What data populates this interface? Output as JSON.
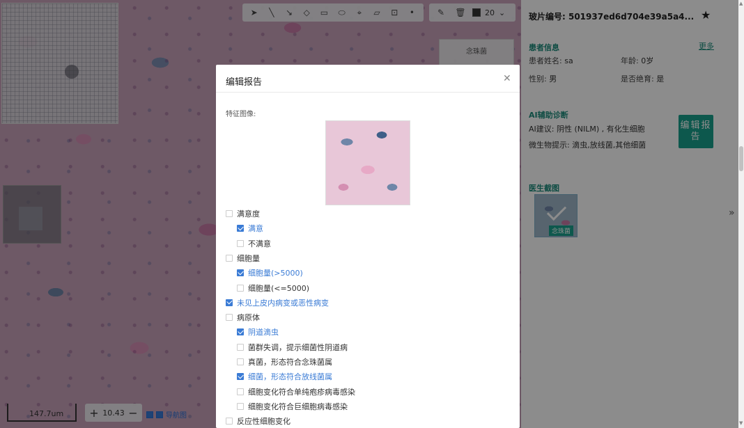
{
  "viewer": {
    "toolbar": {
      "tools": [
        "pointer-icon",
        "line-icon",
        "arrow-icon",
        "eraser-icon",
        "rectangle-icon",
        "ellipse-icon",
        "pin-icon",
        "ruler-icon",
        "crop-icon",
        "dot-icon"
      ],
      "actions": [
        "edit-icon",
        "trash-icon"
      ],
      "color": "#333333",
      "size": "20"
    },
    "labels": [
      "念珠菌",
      "念珠菌"
    ],
    "scale_label": "147.7um",
    "zoom_value": "10.43",
    "zoom_in": "+",
    "zoom_out": "−",
    "bottom_labels": [
      "导航图",
      "导航图"
    ]
  },
  "panel": {
    "slide_id": "玻片编号: 501937ed6d704e39a5a4...",
    "patient": {
      "title": "患者信息",
      "more": "更多",
      "name_label": "患者姓名:",
      "name_value": "sa",
      "age_label": "年龄:",
      "age_value": "0岁",
      "gender_label": "性别:",
      "gender_value": "男",
      "menopause_label": "是否绝育:",
      "menopause_value": "是"
    },
    "ai": {
      "title": "AI辅助诊断",
      "suggestion": "AI建议: 阴性 (NILM) , 有化生细胞",
      "microbe": "微生物提示: 滴虫,放线菌,其他细菌",
      "edit_button": "编辑报告"
    },
    "doctor": {
      "title": "医生截图",
      "shot_tag": "念珠菌"
    }
  },
  "modal": {
    "title": "编辑报告",
    "feature_label": "特征图像:",
    "options": [
      {
        "label": "满意度",
        "checked": false,
        "indent": 0
      },
      {
        "label": "满意",
        "checked": true,
        "indent": 1
      },
      {
        "label": "不满意",
        "checked": false,
        "indent": 1
      },
      {
        "label": "细胞量",
        "checked": false,
        "indent": 0
      },
      {
        "label": "细胞量(>5000)",
        "checked": true,
        "indent": 1
      },
      {
        "label": "细胞量(<=5000)",
        "checked": false,
        "indent": 1
      },
      {
        "label": "未见上皮内病变或恶性病变",
        "checked": true,
        "indent": 0
      },
      {
        "label": "病原体",
        "checked": false,
        "indent": 0
      },
      {
        "label": "阴道滴虫",
        "checked": true,
        "indent": 1
      },
      {
        "label": "菌群失调，提示细菌性阴道病",
        "checked": false,
        "indent": 1
      },
      {
        "label": "真菌，形态符合念珠菌属",
        "checked": false,
        "indent": 1
      },
      {
        "label": "细菌，形态符合放线菌属",
        "checked": true,
        "indent": 1
      },
      {
        "label": "细胞变化符合单纯疱疹病毒感染",
        "checked": false,
        "indent": 1
      },
      {
        "label": "细胞变化符合巨细胞病毒感染",
        "checked": false,
        "indent": 1
      },
      {
        "label": "反应性细胞变化",
        "checked": false,
        "indent": 0
      }
    ]
  }
}
